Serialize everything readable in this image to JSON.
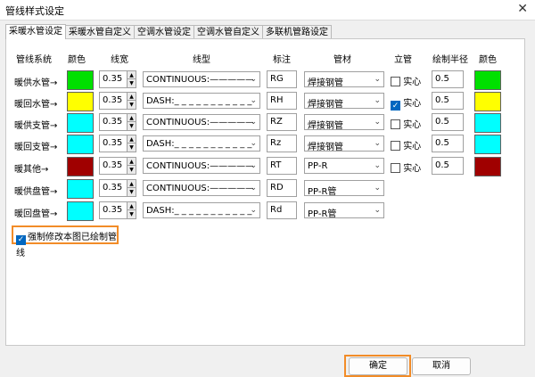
{
  "window": {
    "title": "管线样式设定",
    "close_glyph": "✕"
  },
  "tabs": [
    "采暖水管设定",
    "采暖水管自定义",
    "空调水管设定",
    "空调水管自定义",
    "多联机管路设定"
  ],
  "headers": {
    "system": "管线系统",
    "color": "颜色",
    "width": "线宽",
    "linetype": "线型",
    "label": "标注",
    "material": "管材",
    "riser": "立管",
    "radius": "绘制半径",
    "color2": "颜色"
  },
  "rows": [
    {
      "name": "暖供水管→",
      "color": "#00e000",
      "width": "0.35",
      "linetype": "CONTINUOUS:—————",
      "label": "RG",
      "material": "焊接钢管",
      "has_riser": true,
      "riser_checked": false,
      "riser_label": "实心",
      "radius": "0.5",
      "riser_color": "#00e000"
    },
    {
      "name": "暖回水管→",
      "color": "#ffff00",
      "width": "0.35",
      "linetype": "DASH:_ _ _ _ _ _ _ _ _ _ _ _",
      "label": "RH",
      "material": "焊接钢管",
      "has_riser": true,
      "riser_checked": true,
      "riser_label": "实心",
      "radius": "0.5",
      "riser_color": "#ffff00"
    },
    {
      "name": "暖供支管→",
      "color": "#00ffff",
      "width": "0.35",
      "linetype": "CONTINUOUS:—————",
      "label": "RZ",
      "material": "焊接钢管",
      "has_riser": true,
      "riser_checked": false,
      "riser_label": "实心",
      "radius": "0.5",
      "riser_color": "#00ffff"
    },
    {
      "name": "暖回支管→",
      "color": "#00ffff",
      "width": "0.35",
      "linetype": "DASH:_ _ _ _ _ _ _ _ _ _ _ _",
      "label": "Rz",
      "material": "焊接钢管",
      "has_riser": true,
      "riser_checked": false,
      "riser_label": "实心",
      "radius": "0.5",
      "riser_color": "#00ffff"
    },
    {
      "name": "暖其他→",
      "color": "#a00000",
      "width": "0.35",
      "linetype": "CONTINUOUS:—————",
      "label": "RT",
      "material": "PP-R",
      "has_riser": true,
      "riser_checked": false,
      "riser_label": "实心",
      "radius": "0.5",
      "riser_color": "#a00000"
    },
    {
      "name": "暖供盘管→",
      "color": "#00ffff",
      "width": "0.35",
      "linetype": "CONTINUOUS:—————",
      "label": "RD",
      "material": "PP-R管",
      "has_riser": false
    },
    {
      "name": "暖回盘管→",
      "color": "#00ffff",
      "width": "0.35",
      "linetype": "DASH:_ _ _ _ _ _ _ _ _ _ _ _",
      "label": "Rd",
      "material": "PP-R管",
      "has_riser": false
    }
  ],
  "force_redraw": {
    "label": "强制修改本图已绘制管线",
    "checked": true
  },
  "buttons": {
    "ok": "确定",
    "cancel": "取消"
  }
}
